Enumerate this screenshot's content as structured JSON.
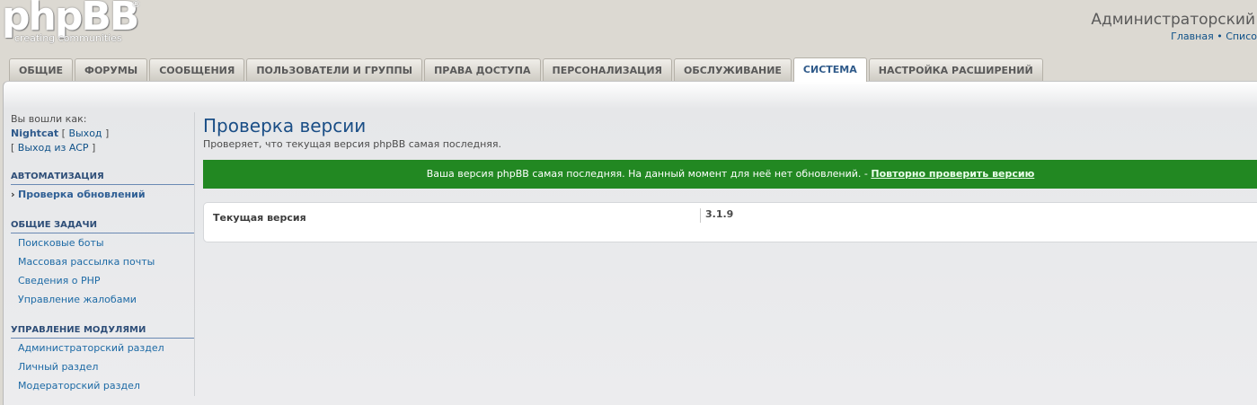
{
  "logo": {
    "name": "phpBB",
    "registered": "®",
    "tagline": "creating communities"
  },
  "header": {
    "title": "Администраторский",
    "links": [
      "Главная",
      "Списо"
    ],
    "link_separator": "•"
  },
  "tabs": [
    {
      "label": "ОБЩИЕ",
      "active": false
    },
    {
      "label": "ФОРУМЫ",
      "active": false
    },
    {
      "label": "СООБЩЕНИЯ",
      "active": false
    },
    {
      "label": "ПОЛЬЗОВАТЕЛИ И ГРУППЫ",
      "active": false
    },
    {
      "label": "ПРАВА ДОСТУПА",
      "active": false
    },
    {
      "label": "ПЕРСОНАЛИЗАЦИЯ",
      "active": false
    },
    {
      "label": "ОБСЛУЖИВАНИЕ",
      "active": false
    },
    {
      "label": "СИСТЕМА",
      "active": true
    },
    {
      "label": "НАСТРОЙКА РАСШИРЕНИЙ",
      "active": false
    }
  ],
  "sidebar": {
    "logged_in_as": "Вы вошли как:",
    "username": "Nightcat",
    "logout_label": "Выход",
    "acp_logout_label": "Выход из ACP",
    "sections": [
      {
        "title": "АВТОМАТИЗАЦИЯ",
        "items": [
          {
            "label": "Проверка обновлений",
            "active": true
          }
        ]
      },
      {
        "title": "ОБЩИЕ ЗАДАЧИ",
        "items": [
          {
            "label": "Поисковые боты",
            "active": false
          },
          {
            "label": "Массовая рассылка почты",
            "active": false
          },
          {
            "label": "Сведения о PHP",
            "active": false
          },
          {
            "label": "Управление жалобами",
            "active": false
          }
        ]
      },
      {
        "title": "УПРАВЛЕНИЕ МОДУЛЯМИ",
        "items": [
          {
            "label": "Администраторский раздел",
            "active": false
          },
          {
            "label": "Личный раздел",
            "active": false
          },
          {
            "label": "Модераторский раздел",
            "active": false
          }
        ]
      }
    ]
  },
  "main": {
    "title": "Проверка версии",
    "description": "Проверяет, что текущая версия phpBB самая последняя.",
    "success_message": "Ваша версия phpBB самая последняя. На данный момент для неё нет обновлений. -",
    "recheck_link": "Повторно проверить версию",
    "current_version_label": "Текущая версия",
    "current_version_value": "3.1.9"
  },
  "colors": {
    "success_bg": "#228822",
    "link": "#105289",
    "active_tab_text": "#2f5a8a"
  }
}
